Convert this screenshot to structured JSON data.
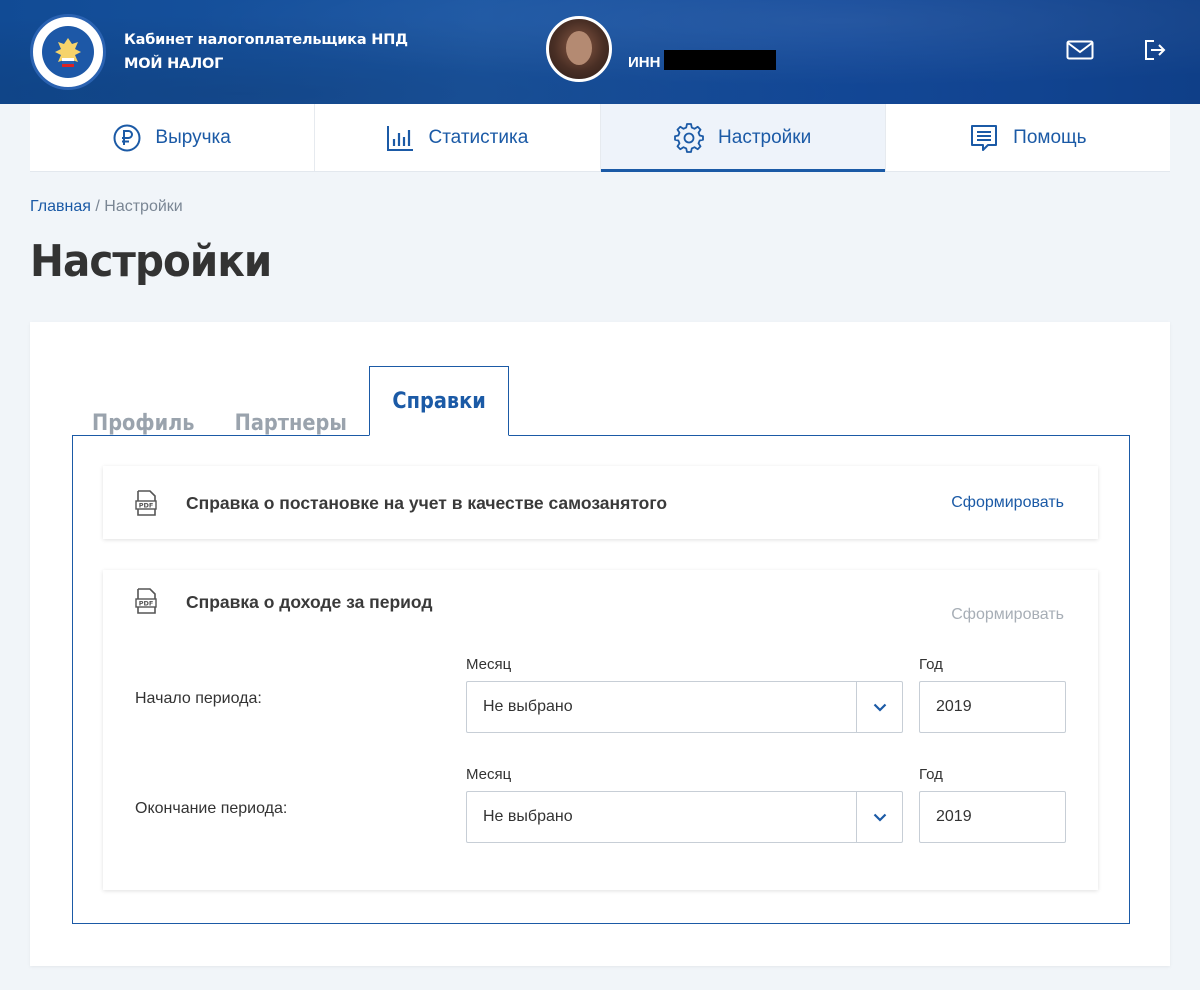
{
  "header": {
    "brand_line1": "Кабинет налогоплательщика НПД",
    "brand_line2": "МОЙ НАЛОГ",
    "inn_label": "ИНН",
    "icons": [
      "emblem-icon",
      "mail-icon",
      "logout-icon"
    ]
  },
  "nav": {
    "items": [
      {
        "label": "Выручка",
        "icon": "ruble-icon",
        "active": false
      },
      {
        "label": "Статистика",
        "icon": "chart-icon",
        "active": false
      },
      {
        "label": "Настройки",
        "icon": "gear-icon",
        "active": true
      },
      {
        "label": "Помощь",
        "icon": "chat-icon",
        "active": false
      }
    ],
    "accent": "#1b5aa6"
  },
  "breadcrumb": {
    "home": "Главная",
    "separator": "/",
    "current": "Настройки"
  },
  "page": {
    "title": "Настройки"
  },
  "subtabs": {
    "items": [
      {
        "label": "Профиль",
        "active": false
      },
      {
        "label": "Партнеры",
        "active": false
      },
      {
        "label": "Справки",
        "active": true
      }
    ]
  },
  "documents": [
    {
      "title": "Справка о постановке на учет в качестве самозанятого",
      "action": "Сформировать",
      "action_enabled": true,
      "icon": "pdf-icon"
    },
    {
      "title": "Справка о доходе за период",
      "action": "Сформировать",
      "action_enabled": false,
      "icon": "pdf-icon",
      "period_start": {
        "label": "Начало периода:",
        "month_label": "Месяц",
        "month_value": "Не выбрано",
        "year_label": "Год",
        "year_value": "2019"
      },
      "period_end": {
        "label": "Окончание периода:",
        "month_label": "Месяц",
        "month_value": "Не выбрано",
        "year_label": "Год",
        "year_value": "2019"
      }
    }
  ]
}
